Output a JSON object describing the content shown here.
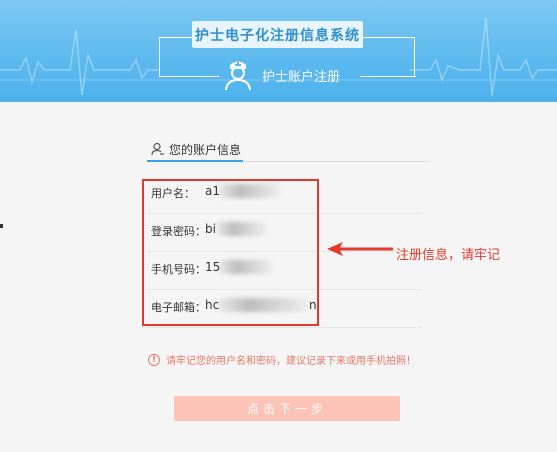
{
  "header": {
    "system_title": "护士电子化注册信息系统",
    "subtitle": "护士账户注册",
    "colors": {
      "bg": "#5cb9ee",
      "title_text": "#2f8fd0"
    }
  },
  "section": {
    "tab_label": "您的账户信息"
  },
  "fields": [
    {
      "label": "用户名：",
      "value": "a1"
    },
    {
      "label": "登录密码：",
      "value": "bi"
    },
    {
      "label": "手机号码：",
      "value": "15"
    },
    {
      "label": "电子邮箱：",
      "value": "hc"
    }
  ],
  "email_tail": "n",
  "annotation": {
    "text": "注册信息，请牢记",
    "color": "#e23b2e"
  },
  "warning": {
    "icon": "exclamation-circle-icon",
    "text": "请牢记您的用户名和密码，建议记录下来或用手机拍照！"
  },
  "next_button": {
    "label": "点击下一步"
  }
}
